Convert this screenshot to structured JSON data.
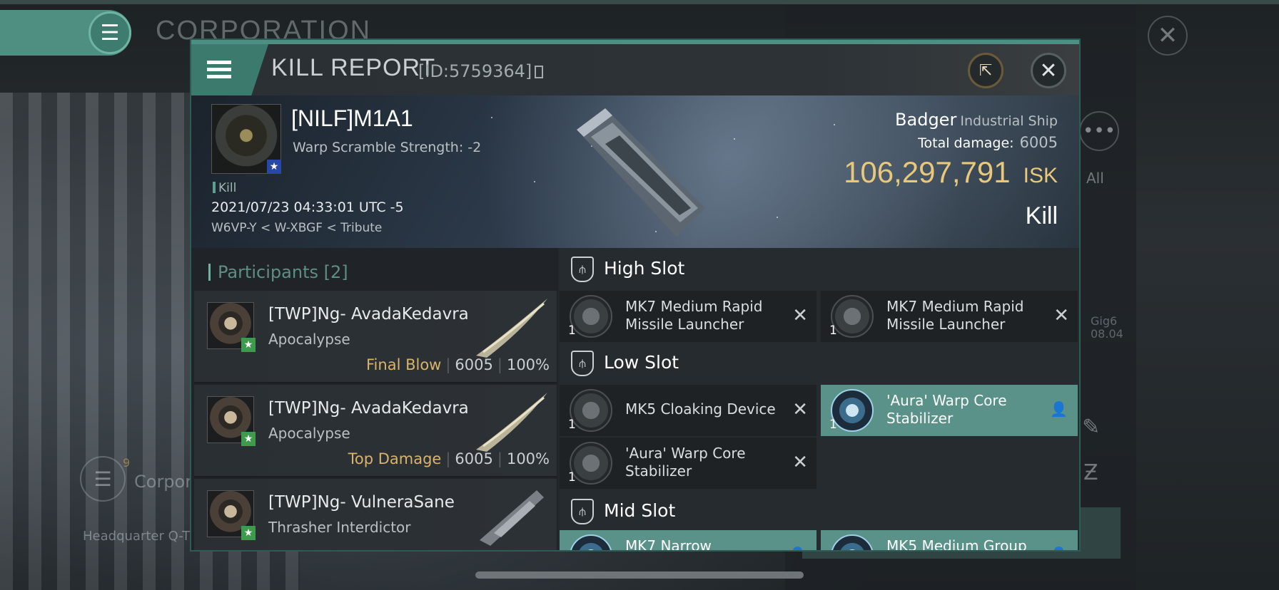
{
  "background": {
    "title": "CORPORATION",
    "all_label": "All",
    "gig_line1": "Gig6",
    "gig_line2": "08.04",
    "corp_badge": "9",
    "corp_label": "Corpora",
    "hq_label": "Headquarter Q-T"
  },
  "header": {
    "title": "KILL REPORT",
    "id": "[ID:5759364]"
  },
  "victim": {
    "name": "[NILF]M1A1",
    "warp_scramble": "Warp Scramble Strength: -2",
    "tag": "Kill",
    "datetime": "2021/07/23 04:33:01 UTC -5",
    "location": "W6VP-Y < W-XBGF < Tribute"
  },
  "ship": {
    "name": "Badger",
    "class": "Industrial Ship",
    "total_damage_label": "Total damage:",
    "total_damage": "6005",
    "isk_value": "106,297,791",
    "isk_unit": "ISK",
    "result": "Kill"
  },
  "participants": {
    "heading": "Participants [2]",
    "rows": [
      {
        "name": "[TWP]Ng- AvadaKedavra",
        "ship": "Apocalypse",
        "label": "Final Blow",
        "damage": "6005",
        "percent": "100%"
      },
      {
        "name": "[TWP]Ng- AvadaKedavra",
        "ship": "Apocalypse",
        "label": "Top Damage",
        "damage": "6005",
        "percent": "100%"
      },
      {
        "name": "[TWP]Ng- VulneraSane",
        "ship": "Thrasher Interdictor"
      }
    ]
  },
  "slots": {
    "high": {
      "title": "High Slot",
      "modules": [
        {
          "name": "MK7 Medium Rapid Missile Launcher",
          "qty": "1",
          "status": "destroyed"
        },
        {
          "name": "MK7 Medium Rapid Missile Launcher",
          "qty": "1",
          "status": "destroyed"
        }
      ]
    },
    "low": {
      "title": "Low Slot",
      "modules": [
        {
          "name": "MK5 Cloaking Device",
          "qty": "1",
          "status": "destroyed"
        },
        {
          "name": "'Aura' Warp Core Stabilizer",
          "qty": "1",
          "status": "dropped"
        },
        {
          "name": "'Aura' Warp Core Stabilizer",
          "qty": "1",
          "status": "destroyed"
        }
      ]
    },
    "mid": {
      "title": "Mid Slot",
      "modules": [
        {
          "name": "MK7 Narrow",
          "status": "dropped"
        },
        {
          "name": "MK5 Medium Group",
          "status": "dropped"
        }
      ]
    }
  },
  "colors": {
    "accent": "#4d8f82",
    "isk_gold": "#e8c87a",
    "dropped_module": "#5a928a",
    "label_gold": "#d9b36a"
  }
}
